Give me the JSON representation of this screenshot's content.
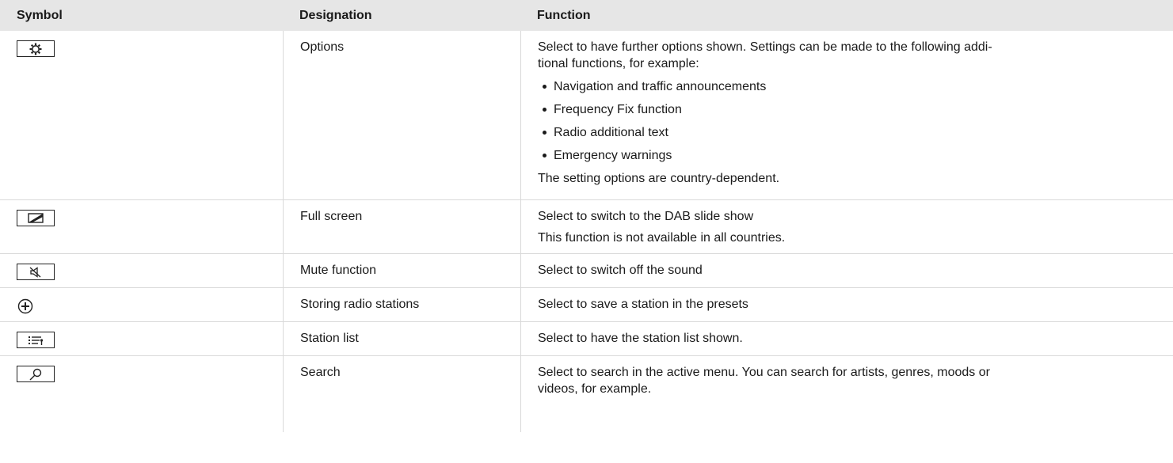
{
  "header": {
    "symbol": "Symbol",
    "designation": "Designation",
    "function": "Function"
  },
  "rows": [
    {
      "icon": "gear-icon",
      "designation": "Options",
      "function_lines": [
        "Select to have further options shown. Settings can be made to the following addi-",
        "tional functions, for example:"
      ],
      "bullets": [
        "Navigation and traffic announcements",
        "Frequency Fix function",
        "Radio additional text",
        "Emergency warnings"
      ],
      "note": "The setting options are country-dependent."
    },
    {
      "icon": "full-screen-icon",
      "designation": "Full screen",
      "function": "Select to switch to the DAB slide show",
      "note": "This function is not available in all countries."
    },
    {
      "icon": "mute-icon",
      "designation": "Mute function",
      "function": "Select to switch off the sound"
    },
    {
      "icon": "plus-circle-icon",
      "designation": "Storing radio stations",
      "function": "Select to save a station in the presets"
    },
    {
      "icon": "station-list-icon",
      "designation": "Station list",
      "function": "Select to have the station list shown."
    },
    {
      "icon": "search-icon",
      "designation": "Search",
      "function_lines": [
        "Select to search in the active menu. You can search for artists, genres, moods or",
        "videos, for example."
      ]
    }
  ]
}
